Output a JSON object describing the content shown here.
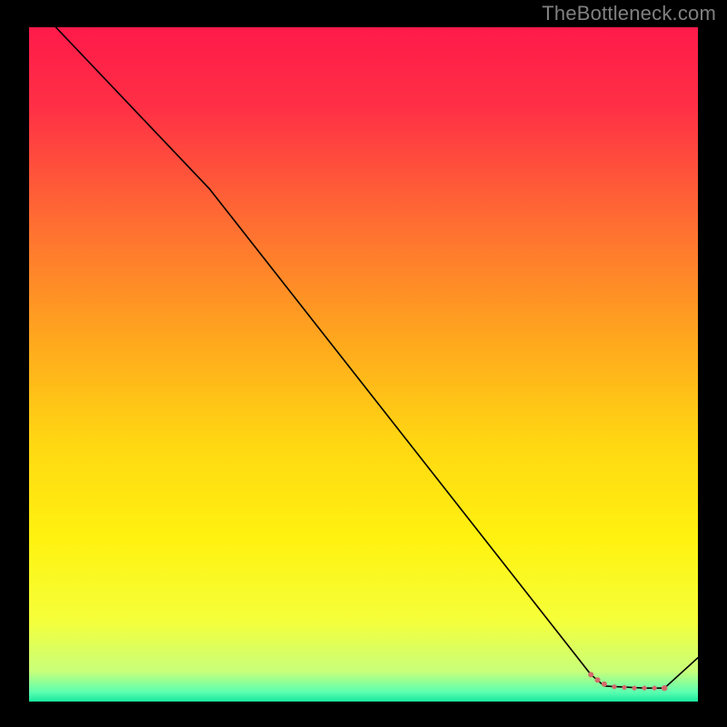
{
  "watermark": "TheBottleneck.com",
  "chart_data": {
    "type": "line",
    "title": "",
    "xlabel": "",
    "ylabel": "",
    "xlim": [
      0,
      100
    ],
    "ylim": [
      0,
      100
    ],
    "background_gradient": [
      {
        "offset": 0.0,
        "color": "#ff1a4a"
      },
      {
        "offset": 0.12,
        "color": "#ff3045"
      },
      {
        "offset": 0.28,
        "color": "#ff6a33"
      },
      {
        "offset": 0.46,
        "color": "#ffa61e"
      },
      {
        "offset": 0.62,
        "color": "#ffd812"
      },
      {
        "offset": 0.76,
        "color": "#fff210"
      },
      {
        "offset": 0.88,
        "color": "#f5ff3a"
      },
      {
        "offset": 0.955,
        "color": "#c8ff7a"
      },
      {
        "offset": 0.985,
        "color": "#60ffb0"
      },
      {
        "offset": 1.0,
        "color": "#18e8a0"
      }
    ],
    "series": [
      {
        "name": "bottleneck-curve",
        "stroke": "#000000",
        "stroke_width": 1.6,
        "points": [
          {
            "x": 4.0,
            "y": 100.0
          },
          {
            "x": 27.0,
            "y": 76.0
          },
          {
            "x": 84.0,
            "y": 4.0
          },
          {
            "x": 86.0,
            "y": 2.3
          },
          {
            "x": 92.0,
            "y": 2.0
          },
          {
            "x": 95.0,
            "y": 2.0
          },
          {
            "x": 100.0,
            "y": 6.5
          }
        ]
      }
    ],
    "markers": {
      "name": "highlight-dots",
      "color": "#d36a6a",
      "points": [
        {
          "x": 84.0,
          "y": 4.0,
          "r": 3.0
        },
        {
          "x": 85.0,
          "y": 3.2,
          "r": 3.0
        },
        {
          "x": 86.0,
          "y": 2.6,
          "r": 3.0
        },
        {
          "x": 87.5,
          "y": 2.2,
          "r": 2.6
        },
        {
          "x": 89.0,
          "y": 2.1,
          "r": 2.6
        },
        {
          "x": 90.5,
          "y": 2.0,
          "r": 2.6
        },
        {
          "x": 92.0,
          "y": 2.0,
          "r": 2.6
        },
        {
          "x": 93.5,
          "y": 2.0,
          "r": 2.6
        },
        {
          "x": 95.0,
          "y": 2.0,
          "r": 3.2
        }
      ]
    }
  }
}
